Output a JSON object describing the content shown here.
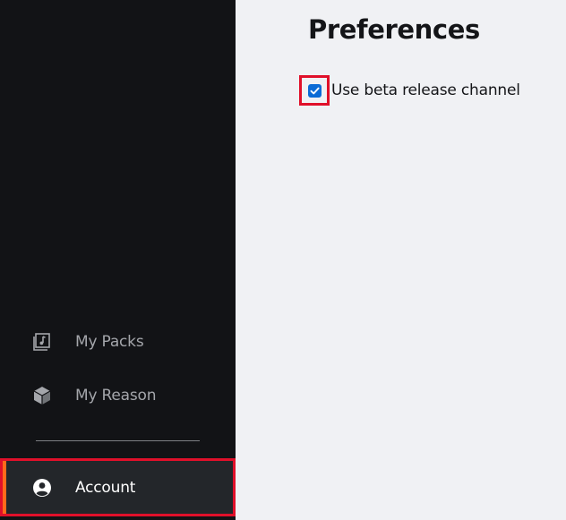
{
  "sidebar": {
    "items": [
      {
        "label": "My Packs",
        "icon": "music-pack-icon"
      },
      {
        "label": "My Reason",
        "icon": "reason-cube-icon"
      }
    ],
    "account": {
      "label": "Account",
      "icon": "user-circle-icon",
      "active": true
    }
  },
  "main": {
    "title": "Preferences",
    "preferences": [
      {
        "label": "Use beta release channel",
        "checked": true
      }
    ]
  },
  "colors": {
    "sidebar_bg": "#121316",
    "main_bg": "#f0f1f4",
    "active_item_bg": "#23262a",
    "accent_orange": "#ff6a1a",
    "highlight_red": "#e0102a",
    "checkbox_blue": "#0b6bd6"
  }
}
